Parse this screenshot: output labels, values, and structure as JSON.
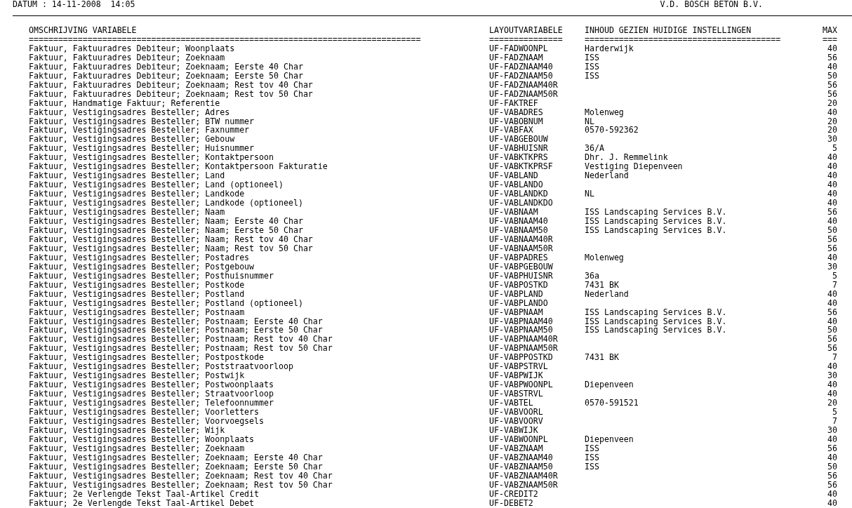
{
  "header": {
    "date": "DATUM : 14-11-2008  14:05",
    "company": "V.D. BOSCH BETON B.V."
  },
  "table": {
    "columns": [
      {
        "label": "OMSCHRIJVING VARIABELE",
        "underline": "================================================================================"
      },
      {
        "label": "LAYOUTVARIABELE",
        "underline": "==============="
      },
      {
        "label": "INHOUD GEZIEN HUIDIGE INSTELLINGEN",
        "underline": "========================================"
      },
      {
        "label": "MAX",
        "underline": "==="
      }
    ],
    "rows": [
      {
        "omschrijving": "Faktuur, Faktuuradres Debiteur; Woonplaats",
        "layoutvariabele": "UF-FADWOONPL",
        "inhoud": "Harderwijk",
        "max": "40"
      },
      {
        "omschrijving": "Faktuur, Faktuuradres Debiteur; Zoeknaam",
        "layoutvariabele": "UF-FADZNAAM",
        "inhoud": "ISS",
        "max": "56"
      },
      {
        "omschrijving": "Faktuur, Faktuuradres Debiteur; Zoeknaam; Eerste 40 Char",
        "layoutvariabele": "UF-FADZNAAM40",
        "inhoud": "ISS",
        "max": "40"
      },
      {
        "omschrijving": "Faktuur, Faktuuradres Debiteur; Zoeknaam; Eerste 50 Char",
        "layoutvariabele": "UF-FADZNAAM50",
        "inhoud": "ISS",
        "max": "50"
      },
      {
        "omschrijving": "Faktuur, Faktuuradres Debiteur; Zoeknaam; Rest tov 40 Char",
        "layoutvariabele": "UF-FADZNAAM40R",
        "max": "56"
      },
      {
        "omschrijving": "Faktuur, Faktuuradres Debiteur; Zoeknaam; Rest tov 50 Char",
        "layoutvariabele": "UF-FADZNAAM50R",
        "max": "56"
      },
      {
        "omschrijving": "Faktuur, Handmatige Faktuur; Referentie",
        "layoutvariabele": "UF-FAKTREF",
        "max": "20"
      },
      {
        "omschrijving": "Faktuur, Vestigingsadres Besteller; Adres",
        "layoutvariabele": "UF-VABADRES",
        "inhoud": "Molenweg",
        "max": "40"
      },
      {
        "omschrijving": "Faktuur, Vestigingsadres Besteller; BTW nummer",
        "layoutvariabele": "UF-VABOBNUM",
        "inhoud": "NL",
        "max": "20"
      },
      {
        "omschrijving": "Faktuur, Vestigingsadres Besteller; Faxnummer",
        "layoutvariabele": "UF-VABFAX",
        "inhoud": "0570-592362",
        "max": "20"
      },
      {
        "omschrijving": "Faktuur, Vestigingsadres Besteller; Gebouw",
        "layoutvariabele": "UF-VABGEBOUW",
        "max": "30"
      },
      {
        "omschrijving": "Faktuur, Vestigingsadres Besteller; Huisnummer",
        "layoutvariabele": "UF-VABHUISNR",
        "inhoud": "36/A",
        "max": "5"
      },
      {
        "omschrijving": "Faktuur, Vestigingsadres Besteller; Kontaktpersoon",
        "layoutvariabele": "UF-VABKTKPRS",
        "inhoud": "Dhr. J. Remmelink",
        "max": "40"
      },
      {
        "omschrijving": "Faktuur, Vestigingsadres Besteller; Kontaktpersoon Fakturatie",
        "layoutvariabele": "UF-VABKTKPRSF",
        "inhoud": "Vestiging Diepenveen",
        "max": "40"
      },
      {
        "omschrijving": "Faktuur, Vestigingsadres Besteller; Land",
        "layoutvariabele": "UF-VABLAND",
        "inhoud": "Nederland",
        "max": "40"
      },
      {
        "omschrijving": "Faktuur, Vestigingsadres Besteller; Land (optioneel)",
        "layoutvariabele": "UF-VABLANDO",
        "max": "40"
      },
      {
        "omschrijving": "Faktuur, Vestigingsadres Besteller; Landkode",
        "layoutvariabele": "UF-VABLANDKD",
        "inhoud": "NL",
        "max": "40"
      },
      {
        "omschrijving": "Faktuur, Vestigingsadres Besteller; Landkode (optioneel)",
        "layoutvariabele": "UF-VABLANDKDO",
        "max": "40"
      },
      {
        "omschrijving": "Faktuur, Vestigingsadres Besteller; Naam",
        "layoutvariabele": "UF-VABNAAM",
        "inhoud": "ISS Landscaping Services B.V.",
        "max": "56"
      },
      {
        "omschrijving": "Faktuur, Vestigingsadres Besteller; Naam; Eerste 40 Char",
        "layoutvariabele": "UF-VABNAAM40",
        "inhoud": "ISS Landscaping Services B.V.",
        "max": "40"
      },
      {
        "omschrijving": "Faktuur, Vestigingsadres Besteller; Naam; Eerste 50 Char",
        "layoutvariabele": "UF-VABNAAM50",
        "inhoud": "ISS Landscaping Services B.V.",
        "max": "50"
      },
      {
        "omschrijving": "Faktuur, Vestigingsadres Besteller; Naam; Rest tov 40 Char",
        "layoutvariabele": "UF-VABNAAM40R",
        "max": "56"
      },
      {
        "omschrijving": "Faktuur, Vestigingsadres Besteller; Naam; Rest tov 50 Char",
        "layoutvariabele": "UF-VABNAAM50R",
        "max": "56"
      },
      {
        "omschrijving": "Faktuur, Vestigingsadres Besteller; Postadres",
        "layoutvariabele": "UF-VABPADRES",
        "inhoud": "Molenweg",
        "max": "40"
      },
      {
        "omschrijving": "Faktuur, Vestigingsadres Besteller; Postgebouw",
        "layoutvariabele": "UF-VABPGEBOUW",
        "max": "30"
      },
      {
        "omschrijving": "Faktuur, Vestigingsadres Besteller; Posthuisnummer",
        "layoutvariabele": "UF-VABPHUISNR",
        "inhoud": "36a",
        "max": "5"
      },
      {
        "omschrijving": "Faktuur, Vestigingsadres Besteller; Postkode",
        "layoutvariabele": "UF-VABPOSTKD",
        "inhoud": "7431 BK",
        "max": "7"
      },
      {
        "omschrijving": "Faktuur, Vestigingsadres Besteller; Postland",
        "layoutvariabele": "UF-VABPLAND",
        "inhoud": "Nederland",
        "max": "40"
      },
      {
        "omschrijving": "Faktuur, Vestigingsadres Besteller; Postland (optioneel)",
        "layoutvariabele": "UF-VABPLANDO",
        "max": "40"
      },
      {
        "omschrijving": "Faktuur, Vestigingsadres Besteller; Postnaam",
        "layoutvariabele": "UF-VABPNAAM",
        "inhoud": "ISS Landscaping Services B.V.",
        "max": "56"
      },
      {
        "omschrijving": "Faktuur, Vestigingsadres Besteller; Postnaam; Eerste 40 Char",
        "layoutvariabele": "UF-VABPNAAM40",
        "inhoud": "ISS Landscaping Services B.V.",
        "max": "40"
      },
      {
        "omschrijving": "Faktuur, Vestigingsadres Besteller; Postnaam; Eerste 50 Char",
        "layoutvariabele": "UF-VABPNAAM50",
        "inhoud": "ISS Landscaping Services B.V.",
        "max": "50"
      },
      {
        "omschrijving": "Faktuur, Vestigingsadres Besteller; Postnaam; Rest tov 40 Char",
        "layoutvariabele": "UF-VABPNAAM40R",
        "max": "56"
      },
      {
        "omschrijving": "Faktuur, Vestigingsadres Besteller; Postnaam; Rest tov 50 Char",
        "layoutvariabele": "UF-VABPNAAM50R",
        "max": "56"
      },
      {
        "omschrijving": "Faktuur, Vestigingsadres Besteller; Postpostkode",
        "layoutvariabele": "UF-VABPPOSTKD",
        "inhoud": "7431 BK",
        "max": "7"
      },
      {
        "omschrijving": "Faktuur, Vestigingsadres Besteller; Poststraatvoorloop",
        "layoutvariabele": "UF-VABPSTRVL",
        "max": "40"
      },
      {
        "omschrijving": "Faktuur, Vestigingsadres Besteller; Postwijk",
        "layoutvariabele": "UF-VABPWIJK",
        "max": "30"
      },
      {
        "omschrijving": "Faktuur, Vestigingsadres Besteller; Postwoonplaats",
        "layoutvariabele": "UF-VABPWOONPL",
        "inhoud": "Diepenveen",
        "max": "40"
      },
      {
        "omschrijving": "Faktuur, Vestigingsadres Besteller; Straatvoorloop",
        "layoutvariabele": "UF-VABSTRVL",
        "max": "40"
      },
      {
        "omschrijving": "Faktuur, Vestigingsadres Besteller; Telefoonnummer",
        "layoutvariabele": "UF-VABTEL",
        "inhoud": "0570-591521",
        "max": "20"
      },
      {
        "omschrijving": "Faktuur, Vestigingsadres Besteller; Voorletters",
        "layoutvariabele": "UF-VABVOORL",
        "max": "5"
      },
      {
        "omschrijving": "Faktuur, Vestigingsadres Besteller; Voorvoegsels",
        "layoutvariabele": "UF-VABVOORV",
        "max": "7"
      },
      {
        "omschrijving": "Faktuur, Vestigingsadres Besteller; Wijk",
        "layoutvariabele": "UF-VABWIJK",
        "max": "30"
      },
      {
        "omschrijving": "Faktuur, Vestigingsadres Besteller; Woonplaats",
        "layoutvariabele": "UF-VABWOONPL",
        "inhoud": "Diepenveen",
        "max": "40"
      },
      {
        "omschrijving": "Faktuur, Vestigingsadres Besteller; Zoeknaam",
        "layoutvariabele": "UF-VABZNAAM",
        "inhoud": "ISS",
        "max": "56"
      },
      {
        "omschrijving": "Faktuur, Vestigingsadres Besteller; Zoeknaam; Eerste 40 Char",
        "layoutvariabele": "UF-VABZNAAM40",
        "inhoud": "ISS",
        "max": "40"
      },
      {
        "omschrijving": "Faktuur, Vestigingsadres Besteller; Zoeknaam; Eerste 50 Char",
        "layoutvariabele": "UF-VABZNAAM50",
        "inhoud": "ISS",
        "max": "50"
      },
      {
        "omschrijving": "Faktuur, Vestigingsadres Besteller; Zoeknaam; Rest tov 40 Char",
        "layoutvariabele": "UF-VABZNAAM40R",
        "max": "56"
      },
      {
        "omschrijving": "Faktuur, Vestigingsadres Besteller; Zoeknaam; Rest tov 50 Char",
        "layoutvariabele": "UF-VABZNAAM50R",
        "max": "56"
      },
      {
        "omschrijving": "Faktuur; 2e Verlengde Tekst Taal-Artikel Credit",
        "layoutvariabele": "UF-CREDIT2",
        "max": "40"
      },
      {
        "omschrijving": "Faktuur; 2e Verlengde Tekst Taal-Artikel Debet",
        "layoutvariabele": "UF-DEBET2",
        "max": "40"
      }
    ]
  }
}
